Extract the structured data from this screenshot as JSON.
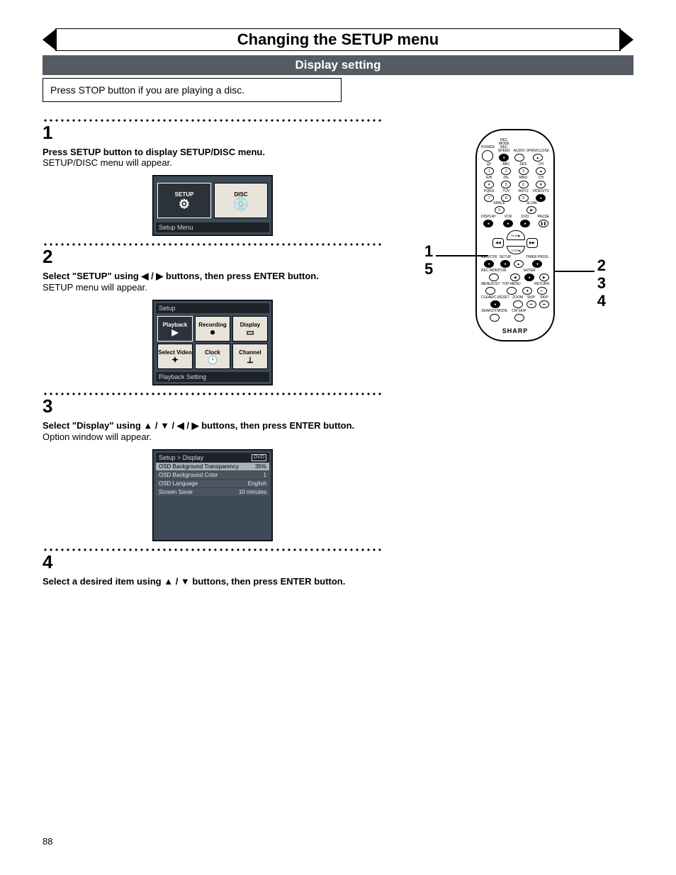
{
  "title": "Changing the SETUP menu",
  "subtitle": "Display setting",
  "note": "Press STOP button if you are playing a disc.",
  "steps": {
    "s1": {
      "num": "1",
      "bold": "Press SETUP button to display SETUP/DISC menu.",
      "plain": "SETUP/DISC menu will appear."
    },
    "s2": {
      "num": "2",
      "bold": "Select \"SETUP\" using ◀ / ▶ buttons, then press ENTER button.",
      "plain": "SETUP menu will appear."
    },
    "s3": {
      "num": "3",
      "bold": "Select \"Display\" using ▲ / ▼ / ◀ / ▶ buttons, then press ENTER button.",
      "plain": "Option window will appear."
    },
    "s4": {
      "num": "4",
      "bold": "Select a desired item using ▲ / ▼ buttons, then press ENTER button."
    }
  },
  "osd1": {
    "setup": "SETUP",
    "disc": "DISC",
    "footer": "Setup Menu"
  },
  "osd2": {
    "header": "Setup",
    "tiles": [
      "Playback",
      "Recording",
      "Display",
      "Select Video",
      "Clock",
      "Channel"
    ],
    "footer": "Playback Setting"
  },
  "osd3": {
    "header": "Setup > Display",
    "badge": "DVD",
    "rows": [
      {
        "l": "OSD Background Transparency",
        "r": "35%"
      },
      {
        "l": "OSD Background Color",
        "r": "1"
      },
      {
        "l": "OSD Language",
        "r": "English"
      },
      {
        "l": "Screen Saver",
        "r": "10 minutes"
      }
    ]
  },
  "remote": {
    "row1": [
      "POWER",
      "REC MODE REC SPEED",
      "AUDIO",
      "OPEN/CLOSE"
    ],
    "numpad": [
      {
        "t": "@!",
        "n": "1"
      },
      {
        "t": "ABC",
        "n": "2"
      },
      {
        "t": "DEF",
        "n": "3"
      },
      {
        "t": "CH",
        "n": "▲"
      },
      {
        "t": "GHI",
        "n": "4"
      },
      {
        "t": "JKL",
        "n": "5"
      },
      {
        "t": "MNO",
        "n": "6"
      },
      {
        "t": "CH",
        "n": "▼"
      },
      {
        "t": "PQRS",
        "n": "7"
      },
      {
        "t": "TUV",
        "n": "8"
      },
      {
        "t": "WXYZ",
        "n": "9"
      },
      {
        "t": "VIDEO/TV",
        "n": "●"
      }
    ],
    "rowSpace": {
      "l": "SPACE",
      "n": "0",
      "r": "SLOW",
      "rn": "▶"
    },
    "rowDisp": [
      "DISPLAY",
      "VCR",
      "DVD",
      "PAUSE"
    ],
    "dpad": {
      "play": "PLAY",
      "stop": "STOP",
      "l": "◀◀",
      "r": "▶▶"
    },
    "rowA": [
      "REC/OTR",
      "SETUP",
      "",
      "TIMER PROG."
    ],
    "rowB": [
      "REC MONITOR",
      "",
      "ENTER",
      ""
    ],
    "rowC": [
      "MENU/LIST",
      "TOP MENU",
      "",
      "RETURN"
    ],
    "rowD": [
      "CLEAR/C.RESET",
      "ZOOM",
      "SKIP",
      "SKIP"
    ],
    "rowE": [
      "SEARCH MODE",
      "CM SKIP"
    ],
    "brand": "SHARP"
  },
  "callouts": {
    "left": [
      "1",
      "5"
    ],
    "right": [
      "2",
      "3",
      "4"
    ]
  },
  "pageNum": "88"
}
